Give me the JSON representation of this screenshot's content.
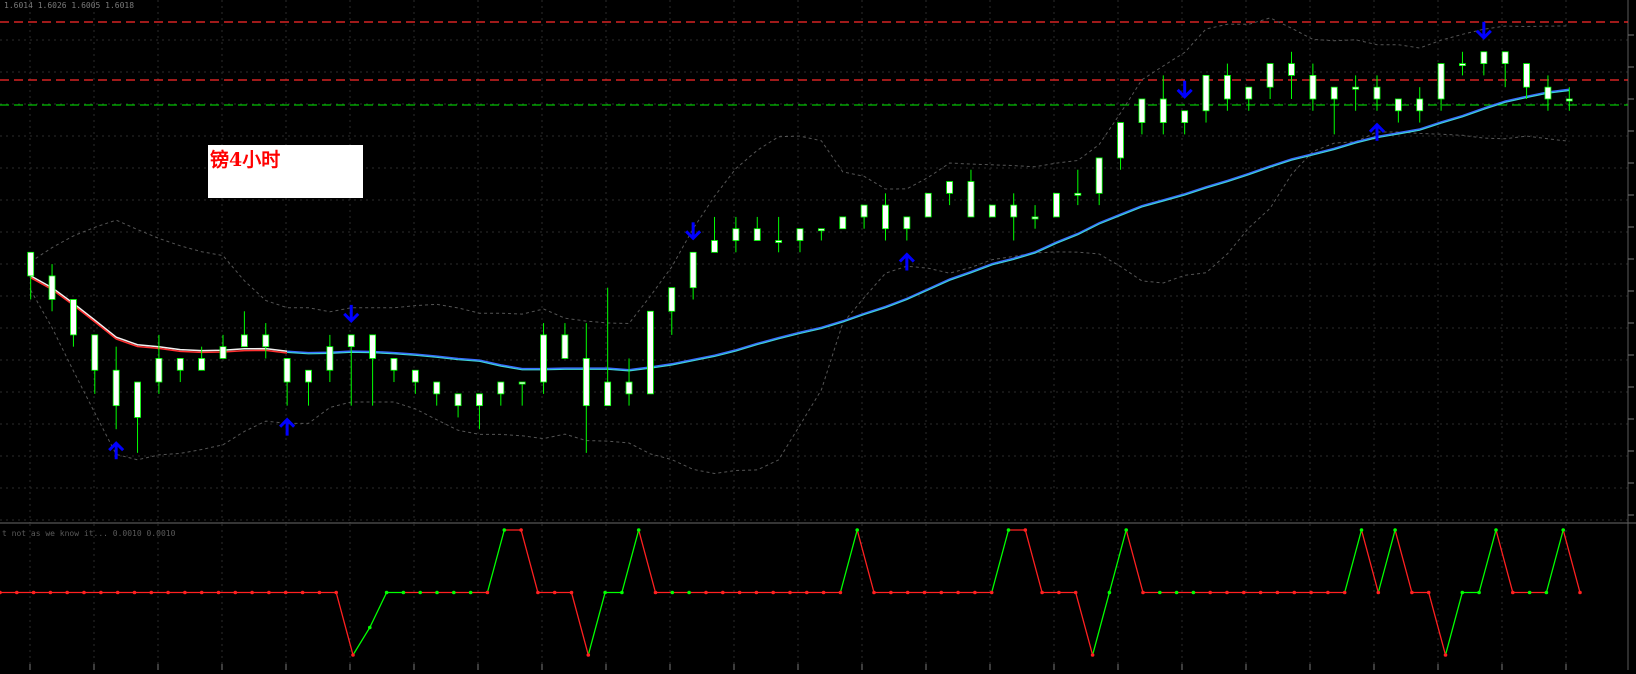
{
  "header": {
    "ohlc_readout": "1.6014 1.6026 1.6005 1.6018"
  },
  "annotation": {
    "text": "镑4小时",
    "text_color": "#ff0000",
    "background": "#ffffff"
  },
  "indicator": {
    "readout": "t not as we know it... 0.0010 0.0010"
  },
  "colors": {
    "background": "#000000",
    "grid": "#2b2b2b",
    "bull_candle": "#00ff00",
    "bull_body": "#ffffff",
    "bear_candle": "#ffffff",
    "bands": "#555555",
    "ma_red": "#ff3030",
    "ma_white": "#f2f2f2",
    "ma_blue": "#3a6dff",
    "ma_cyan": "#3fd2d8",
    "resistance_line": "#ff2a2a",
    "support_line": "#00c000",
    "arrow": "#0000ff",
    "osc_up": "#00ff00",
    "osc_down": "#ff2020"
  },
  "chart_data": [
    {
      "type": "candlestick",
      "title": "",
      "xlabel": "",
      "ylabel": "",
      "y_range": [
        0,
        100
      ],
      "grid": true,
      "candles": [
        [
          83,
          83,
          81,
          79
        ],
        [
          81,
          82,
          79,
          78
        ],
        [
          79,
          79,
          76,
          75
        ],
        [
          76,
          76,
          73,
          71
        ],
        [
          73,
          75,
          70,
          68
        ],
        [
          69,
          72,
          72,
          66
        ],
        [
          72,
          76,
          74,
          71
        ],
        [
          74,
          72,
          73,
          72
        ],
        [
          73,
          75,
          74,
          73
        ],
        [
          74,
          76,
          75,
          74
        ],
        [
          75,
          78,
          76,
          75
        ],
        [
          76,
          77,
          75,
          74
        ],
        [
          74,
          74,
          72,
          70
        ],
        [
          72,
          73,
          73,
          70
        ],
        [
          73,
          76,
          75,
          72
        ],
        [
          75,
          75,
          76,
          70
        ],
        [
          76,
          76,
          74,
          70
        ],
        [
          74,
          74,
          73,
          72
        ],
        [
          73,
          73,
          72,
          71
        ],
        [
          72,
          72,
          71,
          70
        ],
        [
          71,
          71,
          70,
          69
        ],
        [
          70,
          70,
          71,
          68
        ],
        [
          71,
          71,
          72,
          70
        ],
        [
          72,
          72,
          72,
          70
        ],
        [
          72,
          77,
          76,
          71
        ],
        [
          76,
          77,
          74,
          74
        ],
        [
          74,
          77,
          70,
          66
        ],
        [
          70,
          80,
          72,
          70
        ],
        [
          72,
          74,
          71,
          70
        ],
        [
          71,
          77,
          78,
          71
        ],
        [
          78,
          80,
          80,
          76
        ],
        [
          80,
          82,
          83,
          79
        ],
        [
          83,
          86,
          84,
          83
        ],
        [
          84,
          86,
          85,
          83
        ],
        [
          85,
          86,
          84,
          84
        ],
        [
          84,
          86,
          84,
          83
        ],
        [
          84,
          85,
          85,
          83
        ],
        [
          85,
          85,
          85,
          84
        ],
        [
          85,
          86,
          86,
          85
        ],
        [
          86,
          87,
          87,
          85
        ],
        [
          87,
          88,
          85,
          84
        ],
        [
          85,
          85,
          86,
          84
        ],
        [
          86,
          88,
          88,
          86
        ],
        [
          88,
          88,
          89,
          87
        ],
        [
          89,
          90,
          86,
          86
        ],
        [
          86,
          87,
          87,
          86
        ],
        [
          87,
          88,
          86,
          84
        ],
        [
          86,
          87,
          86,
          85
        ],
        [
          86,
          87,
          88,
          86
        ],
        [
          88,
          90,
          88,
          87
        ],
        [
          88,
          89,
          91,
          87
        ],
        [
          91,
          92,
          94,
          90
        ],
        [
          94,
          96,
          96,
          93
        ],
        [
          96,
          98,
          94,
          93
        ],
        [
          94,
          95,
          95,
          93
        ],
        [
          95,
          97,
          98,
          94
        ],
        [
          98,
          99,
          96,
          95
        ],
        [
          96,
          97,
          97,
          95
        ],
        [
          97,
          98,
          99,
          96
        ],
        [
          99,
          100,
          98,
          96
        ],
        [
          98,
          99,
          96,
          95
        ],
        [
          96,
          97,
          97,
          93
        ],
        [
          97,
          98,
          97,
          95
        ],
        [
          97,
          98,
          96,
          95
        ],
        [
          96,
          96,
          95,
          94
        ],
        [
          95,
          97,
          96,
          94
        ],
        [
          96,
          98,
          99,
          95
        ],
        [
          99,
          100,
          99,
          98
        ],
        [
          99,
          99,
          100,
          98
        ],
        [
          100,
          100,
          99,
          97
        ],
        [
          99,
          99,
          97,
          96
        ],
        [
          97,
          98,
          96,
          95
        ],
        [
          96,
          97,
          96,
          95
        ]
      ],
      "x_tick_labels": [],
      "y_tick_labels": [],
      "resistance_lines": [
        2,
        2
      ],
      "support_line": 1,
      "arrows_up": [
        4,
        12,
        41,
        63
      ],
      "arrows_down": [
        15,
        31,
        54,
        68
      ]
    },
    {
      "type": "line",
      "title": "",
      "xlabel": "",
      "ylabel": "",
      "y_range": [
        0,
        100
      ],
      "grid": true,
      "series": [
        {
          "values": [
            50,
            50,
            50,
            50,
            50,
            50,
            50,
            50,
            50,
            50,
            50,
            50,
            50,
            50,
            50,
            50,
            50,
            50,
            50,
            50,
            50,
            0,
            22,
            50,
            50,
            50,
            50,
            50,
            50,
            50,
            100,
            100,
            50,
            50,
            50,
            0,
            50,
            50,
            100,
            50,
            50,
            50,
            50,
            50,
            50,
            50,
            50,
            50,
            50,
            50,
            50,
            100,
            50,
            50,
            50,
            50,
            50,
            50,
            50,
            50,
            100,
            100,
            50,
            50,
            50,
            0,
            50,
            100,
            50,
            50,
            50,
            50,
            50,
            50,
            50,
            50,
            50,
            50,
            50,
            50,
            50,
            100,
            50,
            100,
            50,
            50,
            0,
            50,
            50,
            100,
            50,
            50,
            50,
            100,
            50
          ]
        }
      ]
    }
  ]
}
